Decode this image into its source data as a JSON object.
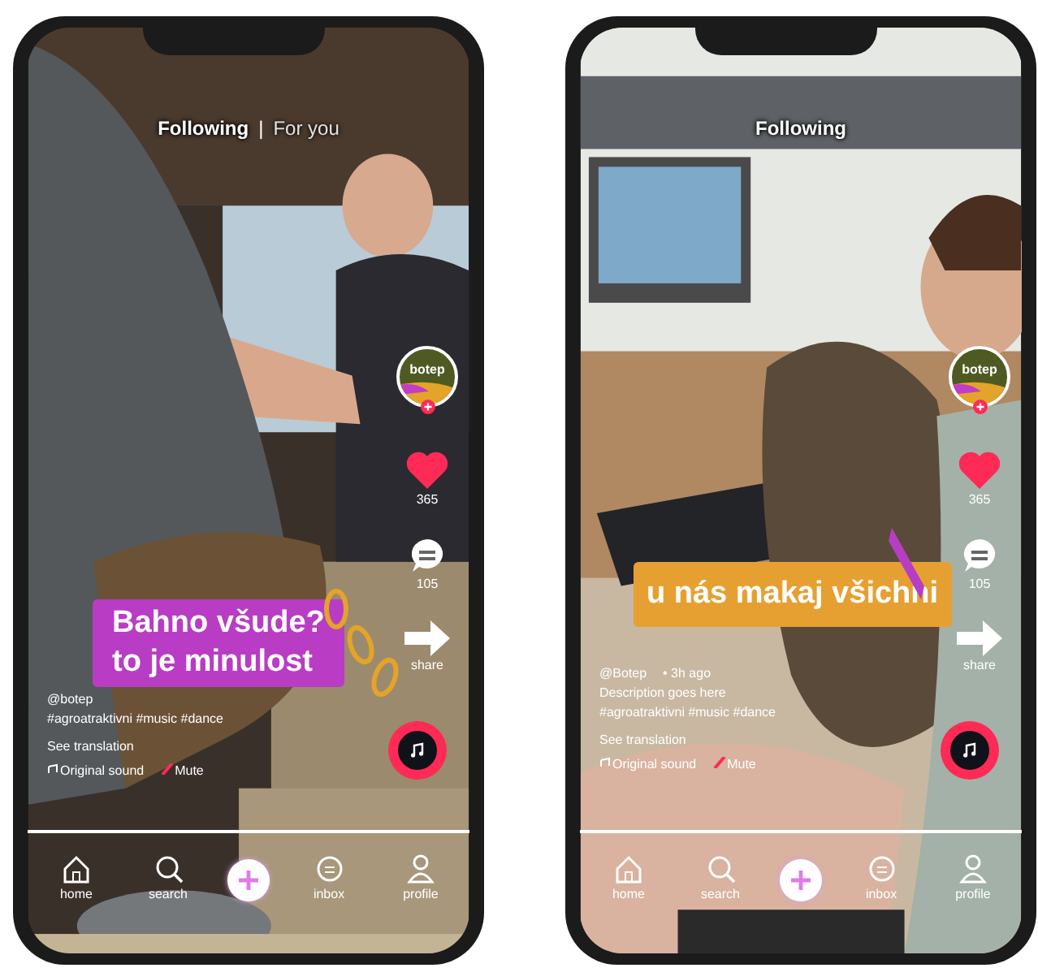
{
  "phones": [
    {
      "header": {
        "tabs": [
          {
            "label": "Following",
            "selected": true
          },
          {
            "label": "For you",
            "selected": false
          }
        ],
        "separator": "|"
      },
      "avatar": {
        "logo": "botep"
      },
      "actions": {
        "likes": "365",
        "comments": "105",
        "share": "share"
      },
      "caption": {
        "lines": [
          "Bahno všude?",
          "to je minulost"
        ],
        "color": "#b83dc4"
      },
      "post": {
        "handle": "@botep",
        "hashtags": "#agroatraktivni #music #dance",
        "translation": "See translation",
        "sound": "Original sound",
        "mute": "Mute"
      },
      "nav": [
        "home",
        "search",
        "inbox",
        "profile"
      ]
    },
    {
      "header": {
        "tabs": [
          {
            "label": "Following",
            "selected": true
          }
        ]
      },
      "avatar": {
        "logo": "botep"
      },
      "actions": {
        "likes": "365",
        "comments": "105",
        "share": "share"
      },
      "caption": {
        "lines": [
          "u nás makaj všichni"
        ],
        "color": "#e6a032"
      },
      "post": {
        "handle": "@Botep",
        "time": "• 3h ago",
        "description": "Description goes here",
        "hashtags": "#agroatraktivni #music #dance",
        "translation": "See translation",
        "sound": "Original sound",
        "mute": "Mute"
      },
      "nav": [
        "home",
        "search",
        "inbox",
        "profile"
      ]
    }
  ]
}
